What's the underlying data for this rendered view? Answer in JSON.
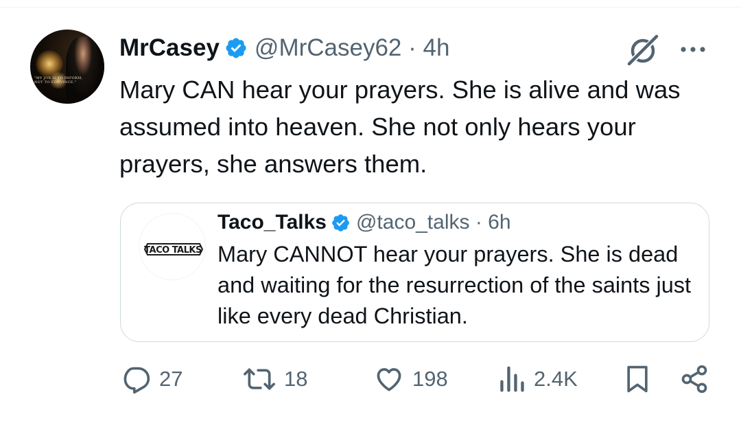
{
  "author": {
    "display_name": "MrCasey",
    "handle_time": "@MrCasey62 · 4h",
    "avatar_caption": [
      "\"MY JOB IS TO INFORM,",
      "NOT TO CONVINCE.\""
    ]
  },
  "tweet": {
    "text": "Mary CAN hear your prayers. She is alive and was assumed into heaven. She not only hears your prayers, she answers them."
  },
  "quote": {
    "display_name": "Taco_Talks",
    "handle_time": "@taco_talks · 6h",
    "avatar_label": "TACO TALKS",
    "text": "Mary CANNOT hear your prayers. She is dead and waiting for the resurrection of the saints just like every dead Christian."
  },
  "actions": {
    "replies": "27",
    "reposts": "18",
    "likes": "198",
    "views": "2.4K"
  },
  "colors": {
    "verified": "#1d9bf0",
    "secondary_text": "#536471",
    "border": "#cfd9de"
  },
  "icons": [
    "verified-badge-icon",
    "grok-icon",
    "more-icon",
    "reply-icon",
    "repost-icon",
    "like-icon",
    "views-icon",
    "bookmark-icon",
    "share-icon"
  ]
}
